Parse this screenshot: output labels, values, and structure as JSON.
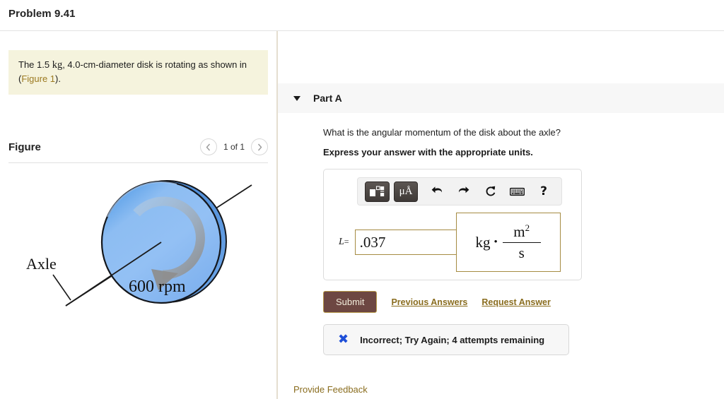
{
  "header": {
    "title": "Problem 9.41"
  },
  "statement": {
    "text_before": "The 1.5 ",
    "unit": "kg",
    "text_middle": ", 4.0-cm-diameter disk is rotating as shown in (",
    "link": "Figure 1",
    "text_after": ")."
  },
  "figure": {
    "title": "Figure",
    "pager_label": "1 of 1",
    "prev_icon": "chevron-left-icon",
    "next_icon": "chevron-right-icon",
    "axle_label": "Axle",
    "rpm_label": "600 rpm",
    "disk_color": "#7fb2ef",
    "disk_edge_color": "#4f8fdc"
  },
  "part": {
    "label": "Part A",
    "caret_icon": "caret-down-icon",
    "question": "What is the angular momentum of the disk about the axle?",
    "instruction": "Express your answer with the appropriate units."
  },
  "toolbar": {
    "template_button_icon": "math-template-icon",
    "units_button_label": "μÅ",
    "undo_icon": "⮏",
    "redo_icon": "⮐",
    "reset_icon": "⟳",
    "keyboard_icon": "keyboard-icon",
    "help_icon": "?"
  },
  "answer": {
    "variable": "L",
    "equals": "=",
    "value": ".037",
    "placeholder": "",
    "units": {
      "base": "kg",
      "dot": "•",
      "numerator": "m",
      "numerator_exponent": "2",
      "denominator": "s"
    },
    "border_color": "#a58b42"
  },
  "actions": {
    "submit_label": "Submit",
    "previous_answers_label": "Previous Answers",
    "request_answer_label": "Request Answer",
    "submit_bg": "#6d4742"
  },
  "feedback": {
    "icon": "x-mark-icon",
    "icon_color": "#1e4fd8",
    "message": "Incorrect; Try Again; 4 attempts remaining"
  },
  "footer": {
    "provide_feedback_label": "Provide Feedback"
  }
}
